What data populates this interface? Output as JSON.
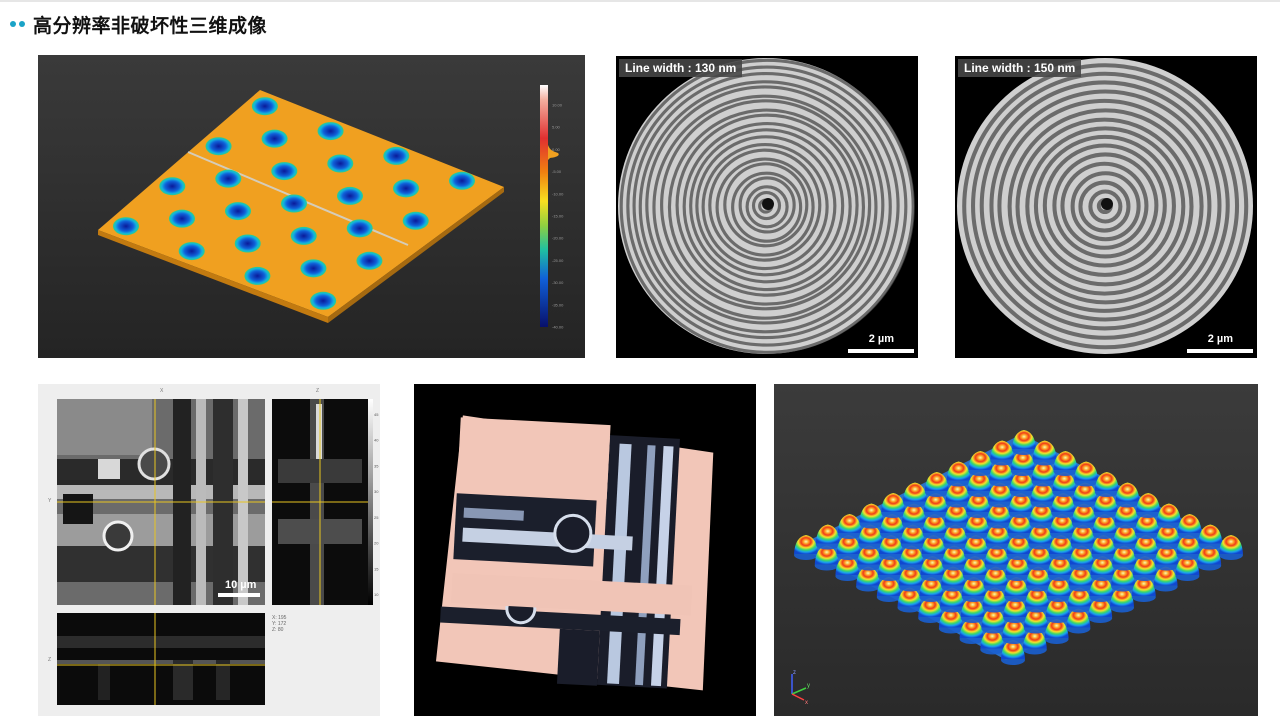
{
  "header": {
    "title": "高分辨率非破坏性三维成像"
  },
  "panels": {
    "surface_map": {
      "colorbar_ticks": [
        "10.00",
        "5.00",
        "0.00",
        "-5.00",
        "-10.00",
        "-15.00",
        "-20.00",
        "-25.00",
        "-30.00",
        "-35.00",
        "-40.00"
      ]
    },
    "ring_130": {
      "label": "Line width : 130 nm",
      "scale": "2 µm"
    },
    "ring_150": {
      "label": "Line width : 150 nm",
      "scale": "2 µm"
    },
    "orthoslice": {
      "axis_x": "X",
      "axis_z": "Z",
      "axis_y": "Y",
      "axis_z2": "Z",
      "scale": "10 µm",
      "coords": [
        "X: 195",
        "Y: 172",
        "Z: 80"
      ],
      "colorbar_ticks": [
        "45",
        "40",
        "35",
        "30",
        "25",
        "20",
        "15",
        "10"
      ]
    },
    "render3d": {},
    "dome_array": {
      "axes": [
        "x",
        "y",
        "z"
      ]
    }
  },
  "colors": {
    "accent": "#1aa3c7",
    "highlight": "#e8c520"
  }
}
